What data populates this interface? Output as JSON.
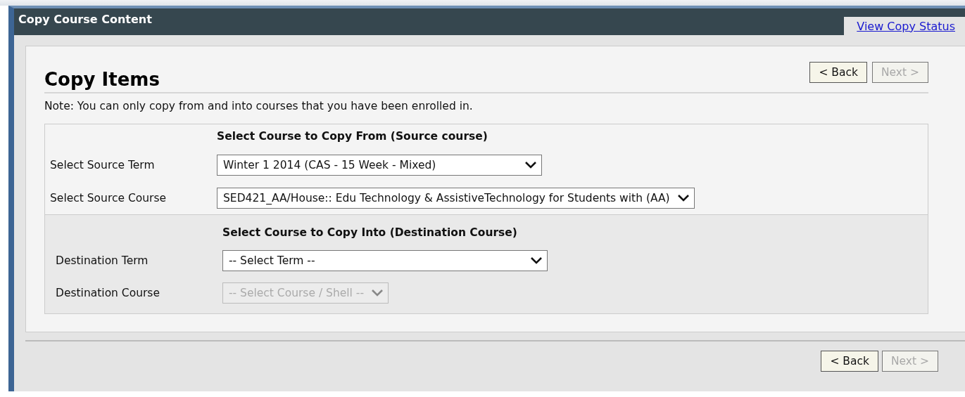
{
  "window": {
    "title": "Copy Course Content"
  },
  "tab_link": "View Copy Status",
  "page": {
    "heading": "Copy Items",
    "note": "Note: You can only copy from and into courses that you have been enrolled in.",
    "top_buttons": [
      {
        "label": "< Back",
        "disabled": false
      },
      {
        "label": "Next >",
        "disabled": true
      }
    ],
    "sections": [
      {
        "heading": "Select Course to Copy From (Source course)",
        "fields": [
          {
            "label": "Select Source Term",
            "value": "Winter 1 2014 (CAS - 15 Week - Mixed)",
            "disabled": false
          },
          {
            "label": "Select Source Course",
            "value": "SED421_AA/House:: Edu Technology & AssistiveTechnology for Students with (AA)",
            "disabled": false
          }
        ]
      },
      {
        "heading": "Select Course to Copy Into (Destination Course)",
        "fields": [
          {
            "label": "Destination Term",
            "value": "-- Select Term --",
            "disabled": false
          },
          {
            "label": "Destination Course",
            "value": "-- Select Course / Shell --",
            "disabled": true
          }
        ]
      }
    ],
    "bottom_buttons": [
      {
        "label": "< Back",
        "disabled": false
      },
      {
        "label": "Next >",
        "disabled": true
      }
    ]
  }
}
